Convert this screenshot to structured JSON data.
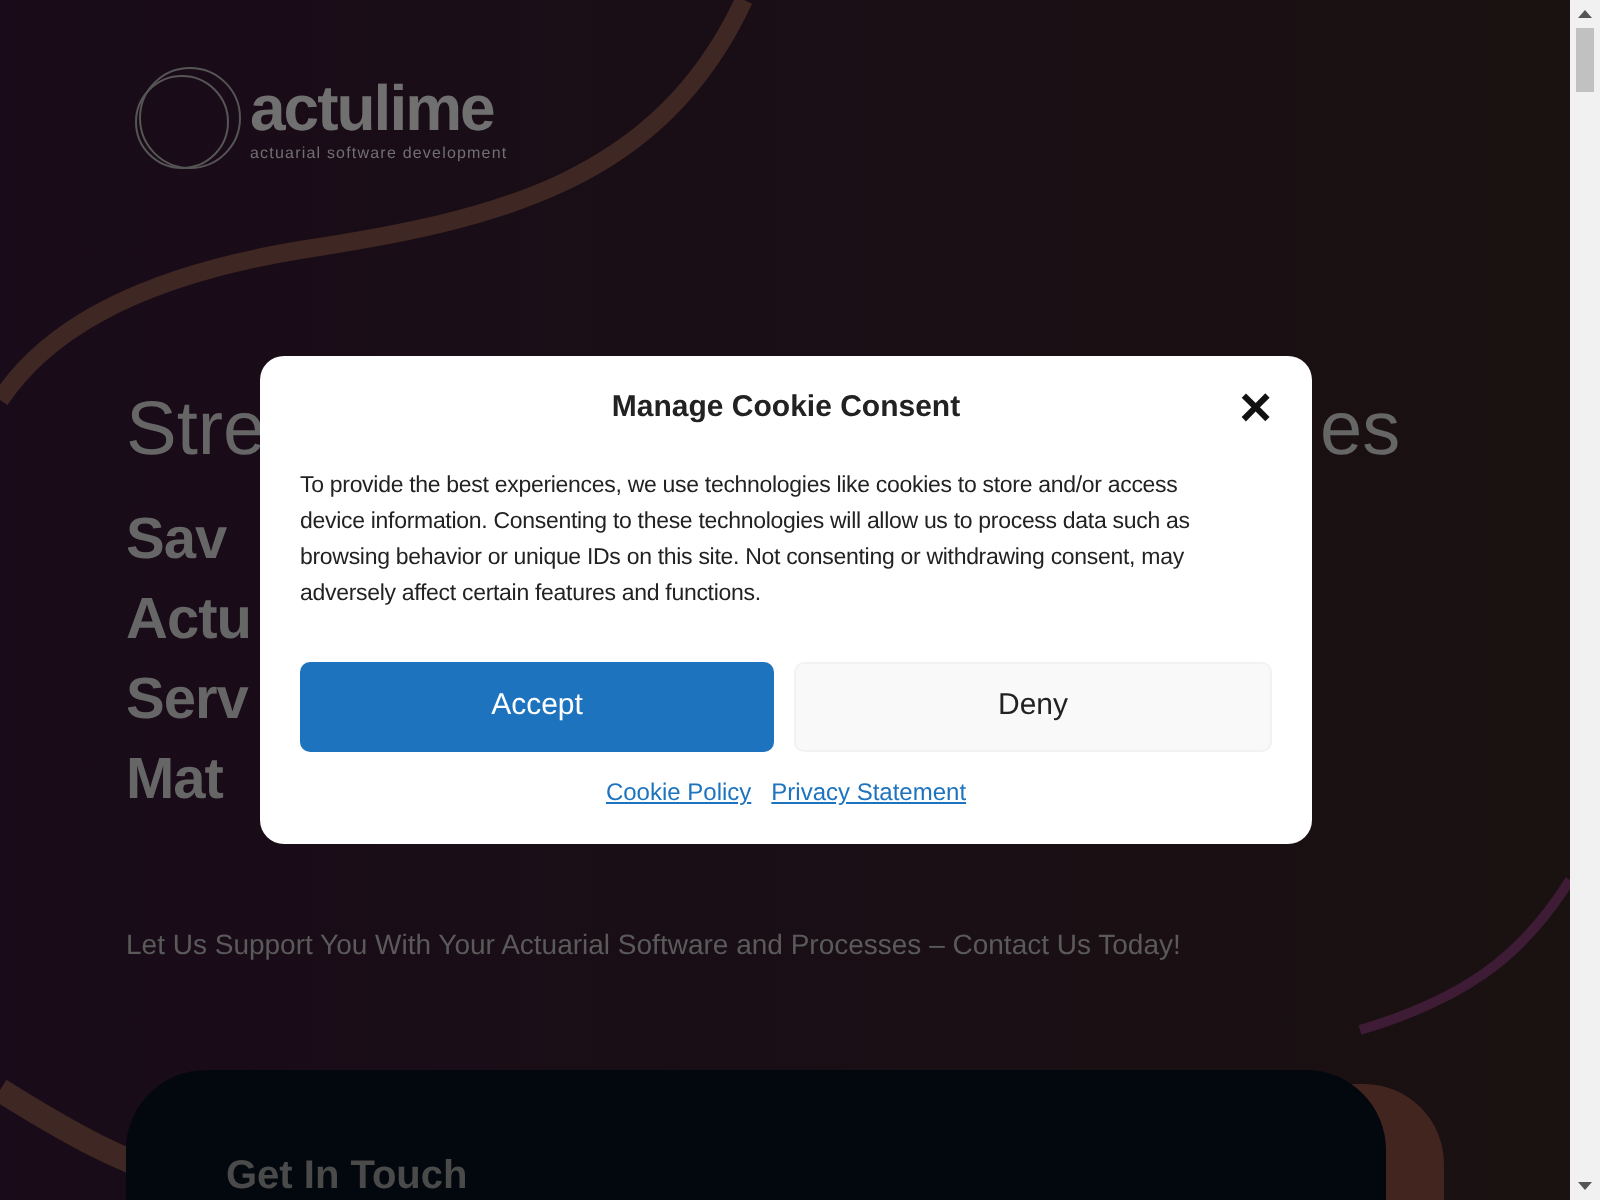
{
  "logo": {
    "name": "actulime",
    "tagline": "actuarial software development"
  },
  "hero": {
    "subtitle_left": "Stre",
    "subtitle_right": "es",
    "title_lines": [
      "Sav",
      "Actu",
      "Serv",
      "Mat"
    ],
    "tagline": "Let Us Support You With Your Actuarial Software and Processes – Contact Us Today!"
  },
  "contact_card": {
    "title": "Get In Touch"
  },
  "cookie_dialog": {
    "title": "Manage Cookie Consent",
    "close": "×",
    "message": "To provide the best experiences, we use technologies like cookies to store and/or access device information. Consenting to these technologies will allow us to process data such as browsing behavior or unique IDs on this site. Not consenting or withdrawing consent, may adversely affect certain features and functions.",
    "buttons": [
      {
        "label": "Accept",
        "kind": "primary"
      },
      {
        "label": "Deny",
        "kind": "secondary"
      }
    ],
    "links": [
      "Cookie Policy",
      "Privacy Statement"
    ]
  }
}
